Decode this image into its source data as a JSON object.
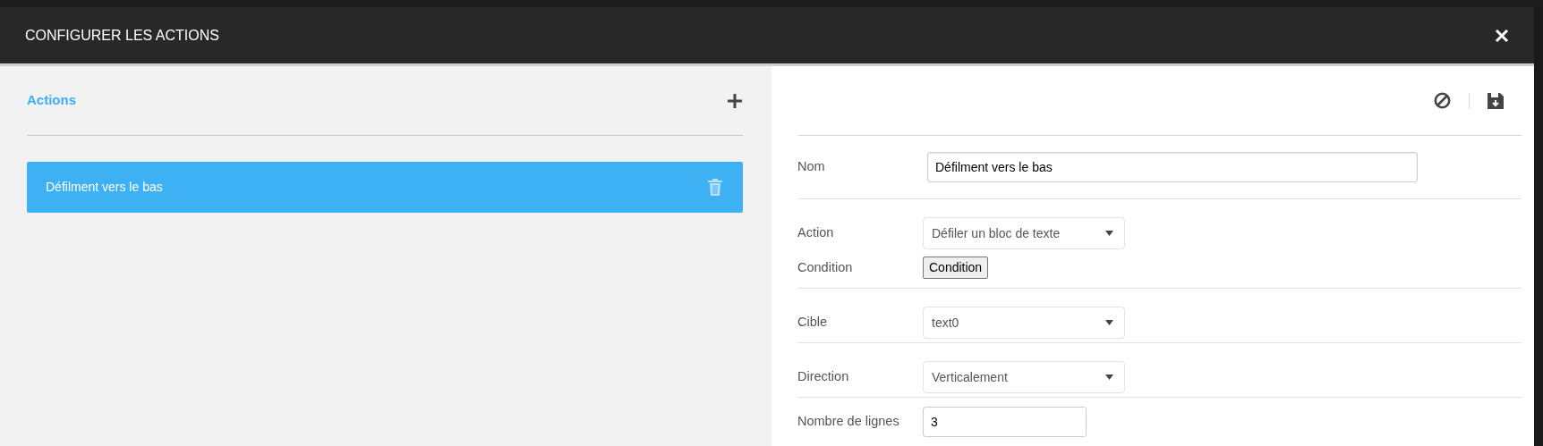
{
  "modal": {
    "title": "CONFIGURER LES ACTIONS"
  },
  "actions_panel": {
    "heading": "Actions",
    "items": [
      {
        "label": "Défilment vers le bas",
        "selected": true
      }
    ]
  },
  "form": {
    "fields": [
      {
        "kind": "text",
        "label": "Nom",
        "value": "Défilment vers le bas",
        "divider": true
      },
      {
        "kind": "select",
        "label": "Action",
        "value": "Défiler un bloc de texte",
        "divider": false
      },
      {
        "kind": "button",
        "label": "Condition",
        "value": "Condition",
        "divider": true
      },
      {
        "kind": "select",
        "label": "Cible",
        "value": "text0",
        "divider": true
      },
      {
        "kind": "select",
        "label": "Direction",
        "value": "Verticalement",
        "divider": true
      },
      {
        "kind": "number",
        "label": "Nombre de lignes",
        "value": "3",
        "divider": false
      }
    ]
  }
}
